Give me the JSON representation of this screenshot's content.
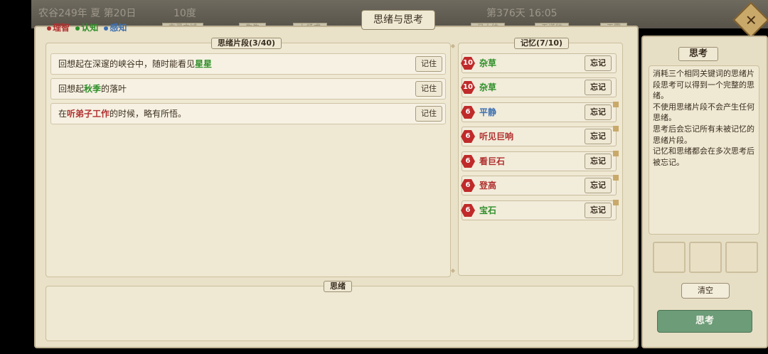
{
  "background": {
    "date_text": "农谷249年 夏 第20日",
    "weather_text": "10度",
    "day_counter": "第376天 16:05",
    "tabs": [
      "玄灵方域",
      "生牛",
      "七场求",
      "马大统",
      "五道监",
      "天霸"
    ]
  },
  "header": {
    "title": "思绪与思考",
    "close_icon": "close-icon"
  },
  "legend": [
    {
      "label": "理智",
      "color": "#b03030"
    },
    {
      "label": "认知",
      "color": "#2f8f2a"
    },
    {
      "label": "感知",
      "color": "#3c6fb0"
    }
  ],
  "fragments_panel": {
    "title": "思绪片段(3/40)",
    "items": [
      {
        "prefix": "回想起在深邃的峡谷中，随时能看见",
        "keyword": "星星",
        "keyword_color": "green",
        "suffix": "",
        "button": "记住"
      },
      {
        "prefix": "回想起",
        "keyword": "秋季",
        "keyword_color": "green",
        "suffix": "的落叶",
        "button": "记住"
      },
      {
        "prefix": "在",
        "keyword": "听弟子工作",
        "keyword_color": "red",
        "suffix": "的时候，略有所悟。",
        "button": "记住"
      }
    ]
  },
  "memory_panel": {
    "title": "记忆(7/10)",
    "items": [
      {
        "count": "10",
        "name": "杂草",
        "color": "green",
        "button": "忘记"
      },
      {
        "count": "10",
        "name": "杂草",
        "color": "green",
        "button": "忘记"
      },
      {
        "count": "6",
        "name": "平静",
        "color": "blue",
        "button": "忘记"
      },
      {
        "count": "6",
        "name": "听见巨响",
        "color": "red",
        "button": "忘记"
      },
      {
        "count": "6",
        "name": "看巨石",
        "color": "red",
        "button": "忘记"
      },
      {
        "count": "6",
        "name": "登高",
        "color": "red",
        "button": "忘记"
      },
      {
        "count": "6",
        "name": "宝石",
        "color": "green",
        "button": "忘记"
      }
    ]
  },
  "thoughts_panel": {
    "title": "思绪"
  },
  "sidebar": {
    "title": "思考",
    "hint": "消耗三个相同关键词的思绪片段思考可以得到一个完整的思绪。\n不使用思绪片段不会产生任何思绪。\n思考后会忘记所有未被记忆的思绪片段。\n记忆和思绪都会在多次思考后被忘记。",
    "clear_button": "清空",
    "think_button": "思考"
  }
}
